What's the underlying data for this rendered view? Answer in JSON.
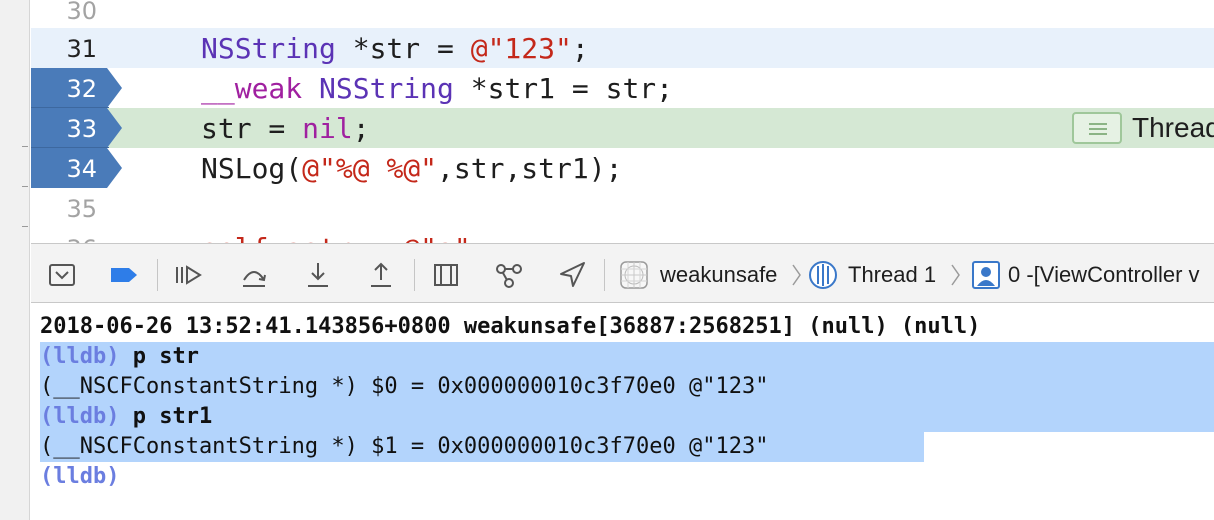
{
  "editor": {
    "lines": [
      {
        "num": "30"
      },
      {
        "num": "31",
        "code": {
          "type": "NSString",
          "rest": " *str = ",
          "str": "@\"123\"",
          "end": ";"
        }
      },
      {
        "num": "32",
        "code": {
          "kw": "__weak",
          "sp": " ",
          "type": "NSString",
          "rest": " *str1 = str;"
        }
      },
      {
        "num": "33",
        "code": {
          "pre": "str = ",
          "kw": "nil",
          "end": ";"
        }
      },
      {
        "num": "34",
        "code": {
          "pre": "NSLog(",
          "str": "@\"%@ %@\"",
          "end": ",str,str1);"
        }
      },
      {
        "num": "35"
      },
      {
        "num": "36",
        "code": {
          "text": "self.astr = @\"a\";"
        }
      }
    ],
    "thread_badge": "Thread"
  },
  "debug_bar": {
    "breadcrumbs": {
      "process": "weakunsafe",
      "thread": "Thread 1",
      "frame": "0 -[ViewController v"
    }
  },
  "console": {
    "log_line": "2018-06-26 13:52:41.143856+0800 weakunsafe[36887:2568251] (null) (null)",
    "entries": [
      {
        "prompt": "(lldb)",
        "command": " p str",
        "output": "(__NSCFConstantString *) $0 = 0x000000010c3f70e0 @\"123\""
      },
      {
        "prompt": "(lldb)",
        "command": " p str1",
        "output": "(__NSCFConstantString *) $1 = 0x000000010c3f70e0 @\"123\""
      }
    ],
    "final_prompt": "(lldb)"
  },
  "colors": {
    "breakpoint": "#4a7bb9",
    "pc_line": "#d5e8d4",
    "current_line": "#e8f1fb",
    "selection": "#b3d4fc",
    "keyword": "#a020a0",
    "type": "#5b33b5",
    "string": "#c4281a",
    "prompt": "#6b7ee0"
  },
  "icons": [
    "hide-debug-area-icon",
    "breakpoints-toggle-icon",
    "continue-icon",
    "step-over-icon",
    "step-into-icon",
    "step-out-icon",
    "view-hierarchy-icon",
    "memory-graph-icon",
    "simulate-location-icon",
    "app-icon",
    "thread-icon",
    "frame-icon"
  ]
}
